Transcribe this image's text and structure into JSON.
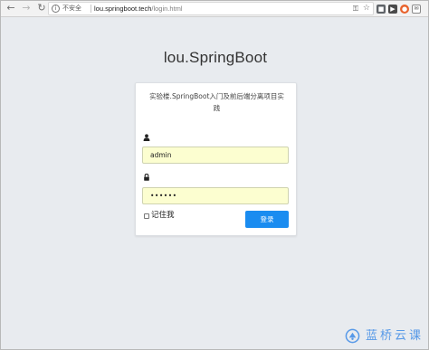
{
  "browser": {
    "security_label": "不安全",
    "url_domain": "lou.springboot.tech",
    "url_path": "/login.html",
    "extensions": [
      "extension-1",
      "extension-2",
      "extension-3",
      "extension-4"
    ]
  },
  "page": {
    "title": "lou.SpringBoot",
    "subtitle": "实验楼.SpringBoot入门及前后端分离项目实践",
    "username_value": "admin",
    "password_value": "••••••",
    "remember_label": "记住我",
    "login_label": "登录",
    "remember_checked": false
  },
  "watermark": {
    "text": "蓝桥云课"
  },
  "colors": {
    "page_bg": "#e8ebef",
    "input_bg": "#fcfed0",
    "button_bg": "#1a8cf0",
    "watermark": "#3d8be6"
  },
  "icons": {
    "back": "back-arrow-icon",
    "forward": "forward-arrow-icon",
    "reload": "reload-icon",
    "info": "info-icon",
    "key": "key-icon",
    "star": "star-icon",
    "user": "user-icon",
    "lock": "lock-icon",
    "logo": "lanqiao-logo-icon"
  }
}
